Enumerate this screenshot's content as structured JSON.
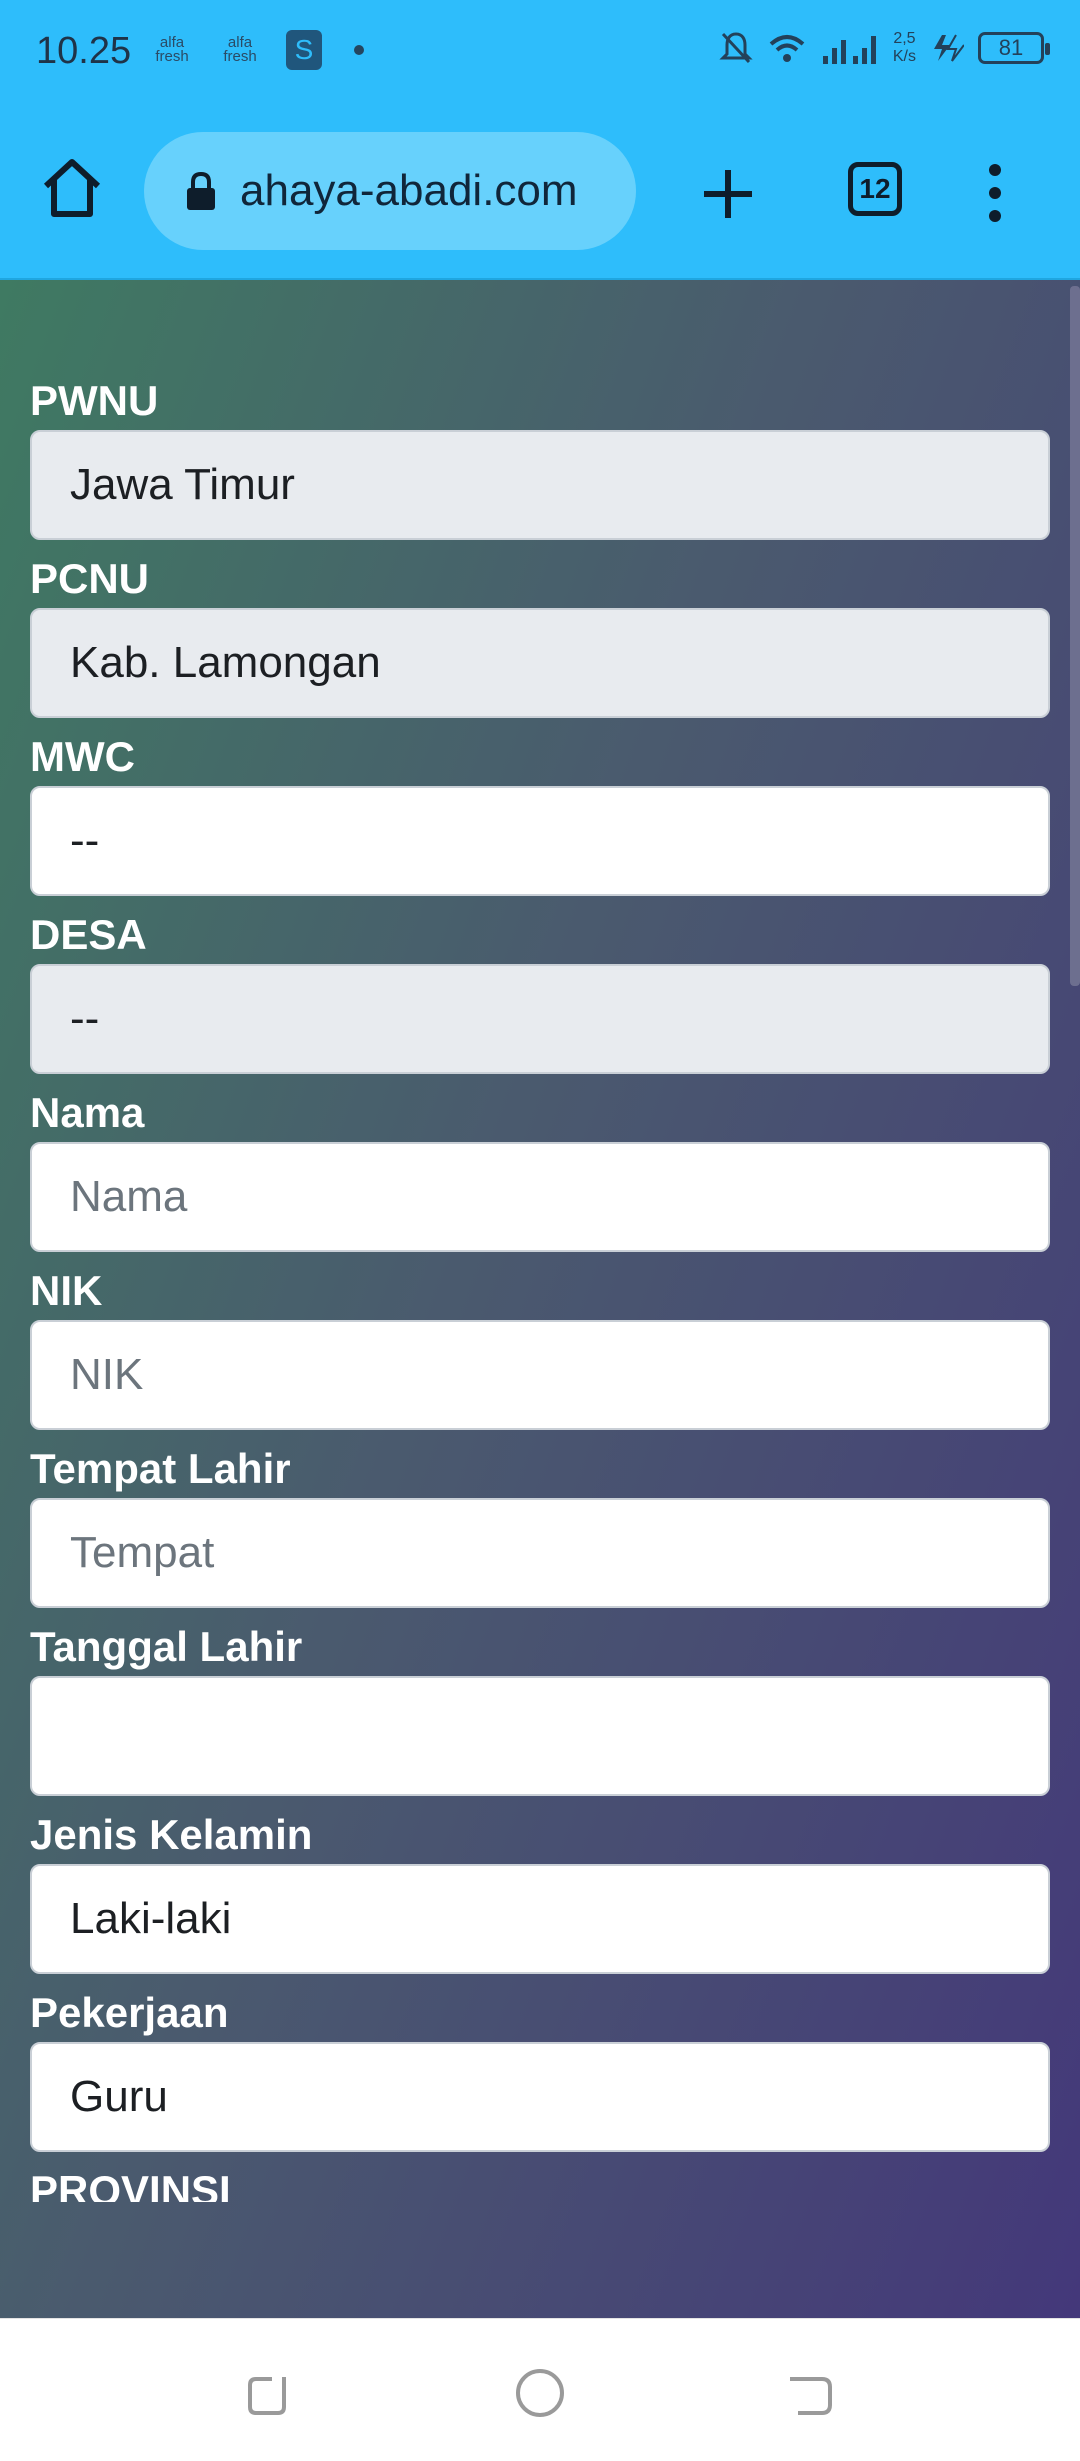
{
  "status_bar": {
    "time": "10.25",
    "app_icon_1": "alfa fresh",
    "app_icon_2": "alfa fresh",
    "shop_icon_letter": "S",
    "speed": "2,5\nK/s",
    "battery": "81"
  },
  "browser": {
    "url": "ahaya-abadi.com",
    "tab_count": "12"
  },
  "form": {
    "pwnu": {
      "label": "PWNU",
      "value": "Jawa Timur"
    },
    "pcnu": {
      "label": "PCNU",
      "value": "Kab. Lamongan"
    },
    "mwc": {
      "label": "MWC",
      "value": "--"
    },
    "desa": {
      "label": "DESA",
      "value": "--"
    },
    "nama": {
      "label": "Nama",
      "placeholder": "Nama"
    },
    "nik": {
      "label": "NIK",
      "placeholder": "NIK"
    },
    "tempat_lahir": {
      "label": "Tempat Lahir",
      "placeholder": "Tempat"
    },
    "tanggal_lahir": {
      "label": "Tanggal Lahir",
      "value": ""
    },
    "jenis_kelamin": {
      "label": "Jenis Kelamin",
      "value": "Laki-laki"
    },
    "pekerjaan": {
      "label": "Pekerjaan",
      "value": "Guru"
    },
    "provinsi": {
      "label": "PROVINSI"
    }
  },
  "colors": {
    "accent": "#2ebdfb",
    "page_gradient_start": "#3f7a62",
    "page_gradient_end": "#44387a"
  }
}
